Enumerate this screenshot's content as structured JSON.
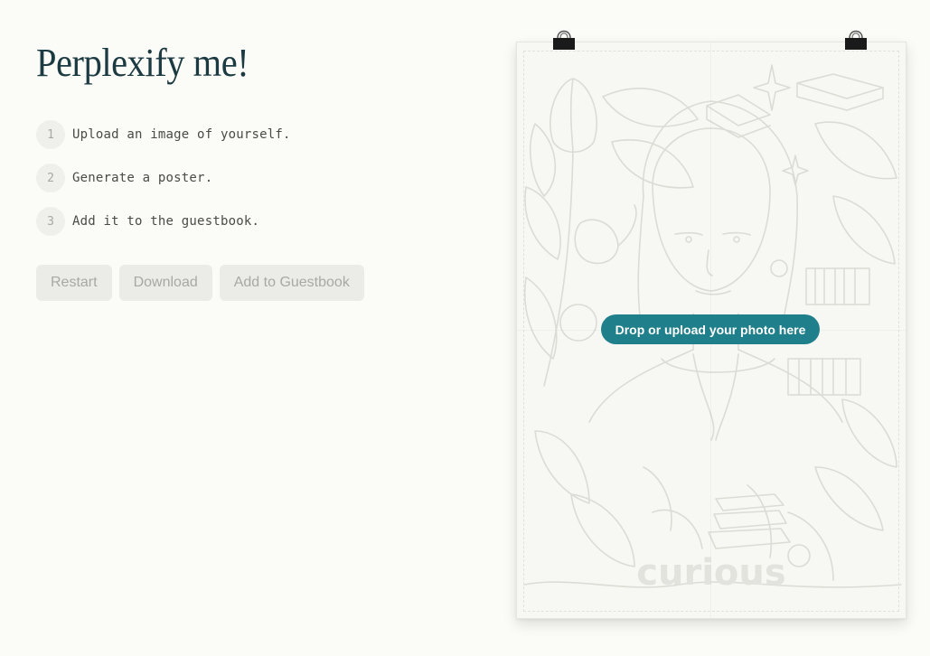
{
  "title": "Perplexify me!",
  "steps": [
    {
      "num": "1",
      "text": "Upload an image of yourself."
    },
    {
      "num": "2",
      "text": "Generate a poster."
    },
    {
      "num": "3",
      "text": "Add it to the guestbook."
    }
  ],
  "buttons": {
    "restart": "Restart",
    "download": "Download",
    "guestbook": "Add to Guestbook"
  },
  "poster": {
    "upload_label": "Drop or upload your photo here",
    "brand": "curious"
  },
  "colors": {
    "accent": "#1f7f8b",
    "title": "#1c3a42",
    "background": "#fbfbf7"
  }
}
